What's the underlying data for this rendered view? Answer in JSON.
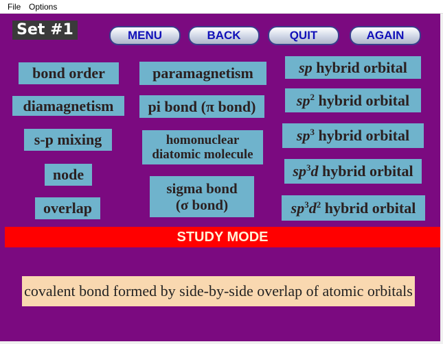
{
  "menubar": {
    "file": "File",
    "options": "Options"
  },
  "set_label": "Set #1",
  "nav": {
    "menu": "MENU",
    "back": "BACK",
    "quit": "QUIT",
    "again": "AGAIN"
  },
  "terms": {
    "bond_order": "bond order",
    "paramagnetism": "paramagnetism",
    "diamagnetism": "diamagnetism",
    "pi_bond": "pi bond (π bond)",
    "sp_mixing": "s-p mixing",
    "homonuclear_line1": "homonuclear",
    "homonuclear_line2": "diatomic molecule",
    "node": "node",
    "sigma_line1": "sigma bond",
    "sigma_line2": "(σ bond)",
    "overlap": "overlap",
    "sp": {
      "base": "sp",
      "rest": " hybrid orbital"
    },
    "sp2": {
      "base": "sp",
      "sup": "2",
      "rest": " hybrid orbital"
    },
    "sp3": {
      "base": "sp",
      "sup": "3",
      "rest": " hybrid orbital"
    },
    "sp3d": {
      "base": "sp",
      "sup": "3",
      "d": "d",
      "rest": " hybrid orbital"
    },
    "sp3d2": {
      "base": "sp",
      "sup": "3",
      "d": "d",
      "sup2": "2",
      "rest": " hybrid orbital"
    }
  },
  "mode_label": "STUDY MODE",
  "definition": "covalent bond formed by side-by-side overlap of atomic orbitals",
  "colors": {
    "background": "#7b0a80",
    "term_box": "#6fb3cc",
    "study_bar": "#ff0000",
    "definition_box": "#f9d8b0",
    "nav_text": "#1010b8"
  }
}
